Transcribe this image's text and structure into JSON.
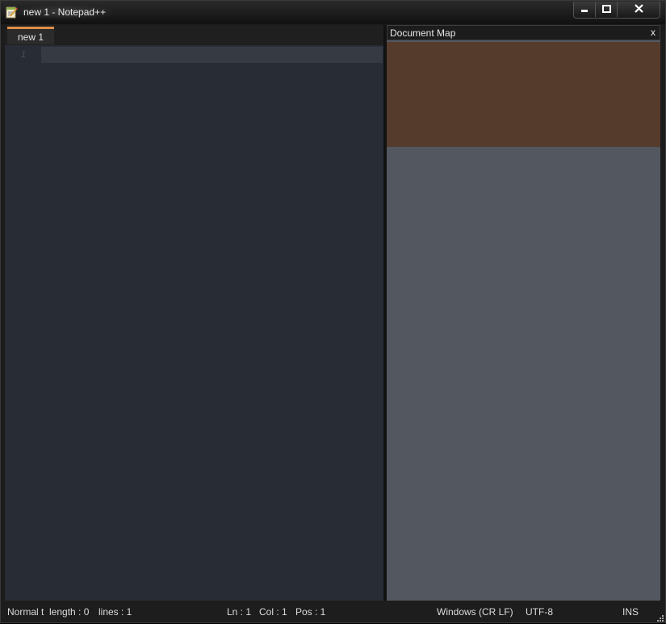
{
  "window": {
    "title": "new 1 - Notepad++",
    "app_icon": "notepad-icon",
    "controls": {
      "minimize_icon": "minimize-icon",
      "maximize_icon": "maximize-icon",
      "close_icon": "close-icon"
    }
  },
  "editor": {
    "tabs": [
      {
        "label": "new 1",
        "active": true,
        "accent_color": "#e08f48"
      }
    ],
    "line_numbers": [
      "1"
    ],
    "background_color": "#282c34"
  },
  "document_map": {
    "title": "Document Map",
    "close_label": "x",
    "viewport_color": "#553b2c",
    "background_color": "#53575f"
  },
  "statusbar": {
    "file_type": "Normal t",
    "length": "length : 0",
    "lines": "lines : 1",
    "ln": "Ln : 1",
    "col": "Col : 1",
    "pos": "Pos : 1",
    "eol": "Windows (CR LF)",
    "encoding": "UTF-8",
    "mode": "INS",
    "grip_icon": "resize-grip-icon"
  }
}
